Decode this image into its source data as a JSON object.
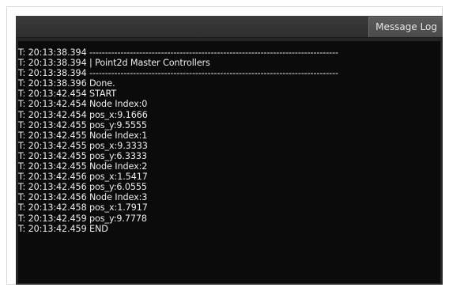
{
  "window": {
    "tab_label": "Message Log"
  },
  "log": {
    "lines": [
      "T: 20:13:38.394 --------------------------------------------------------------------------------",
      "T: 20:13:38.394 | Point2d Master Controllers",
      "T: 20:13:38.394 --------------------------------------------------------------------------------",
      "T: 20:13:38.396 Done.",
      "T: 20:13:42.454 START",
      "T: 20:13:42.454 Node Index:0",
      "T: 20:13:42.454 pos_x:9.1666",
      "T: 20:13:42.455 pos_y:9.5555",
      "T: 20:13:42.455 Node Index:1",
      "T: 20:13:42.455 pos_x:9.3333",
      "T: 20:13:42.455 pos_y:6.3333",
      "T: 20:13:42.455 Node Index:2",
      "T: 20:13:42.456 pos_x:1.5417",
      "T: 20:13:42.456 pos_y:6.0555",
      "T: 20:13:42.456 Node Index:3",
      "T: 20:13:42.458 pos_x:1.7917",
      "T: 20:13:42.459 pos_y:9.7778",
      "T: 20:13:42.459 END"
    ]
  },
  "colors": {
    "panel_background": "#262626",
    "log_background": "#0b0b0b",
    "log_text": "#ececec",
    "tab_background": "#4a4a4a"
  }
}
